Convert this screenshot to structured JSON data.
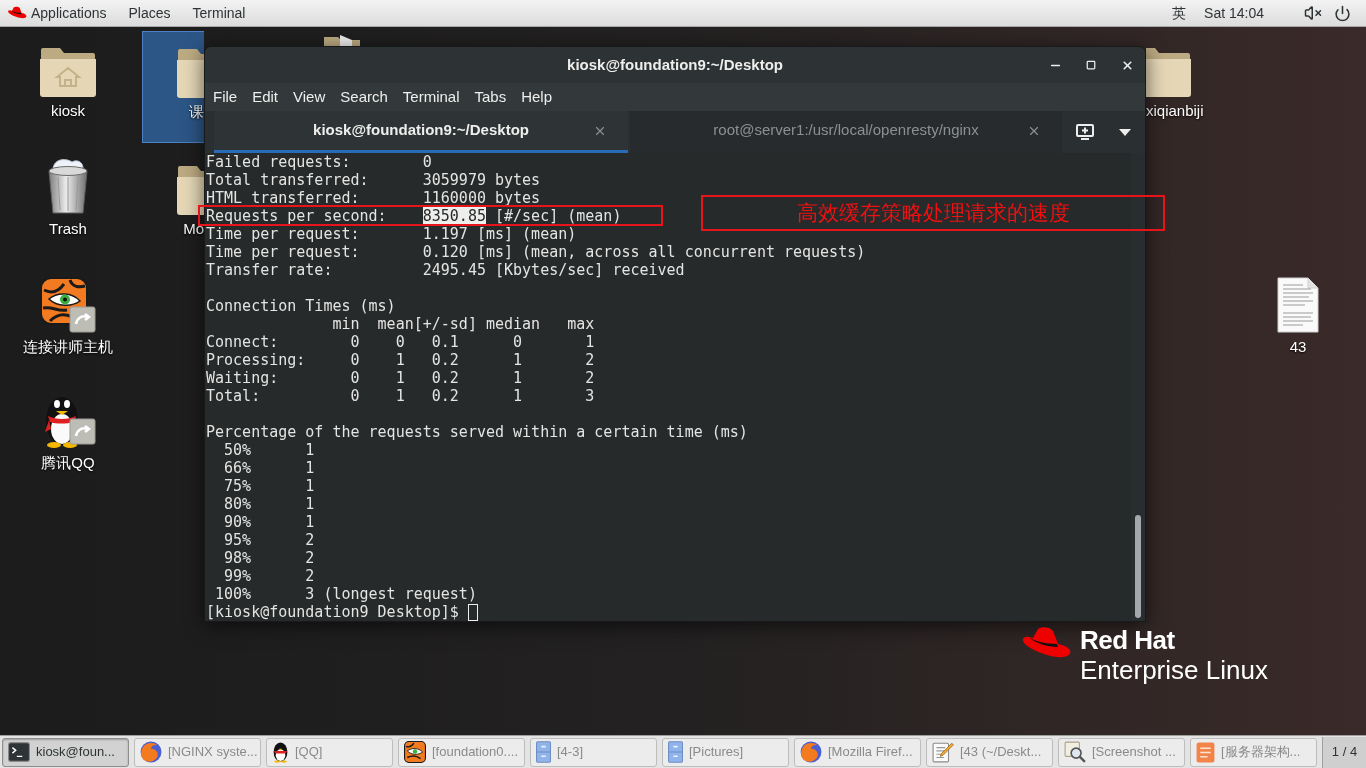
{
  "top_bar": {
    "menus": [
      "Applications",
      "Places",
      "Terminal"
    ],
    "input_method": "英",
    "clock": "Sat 14:04"
  },
  "desktop_icons": [
    {
      "kind": "home-folder",
      "label": "kiosk",
      "selected": false
    },
    {
      "kind": "trash",
      "label": "Trash",
      "selected": false
    },
    {
      "kind": "remote-app",
      "label": "连接讲师主机",
      "selected": false
    },
    {
      "kind": "chat-app",
      "label": "腾讯QQ",
      "selected": false
    },
    {
      "kind": "folder",
      "label": "课",
      "selected": true
    },
    {
      "kind": "folder",
      "label": "Mo",
      "selected": false
    },
    {
      "kind": "folder",
      "label": "xiqianbiji",
      "selected": false
    },
    {
      "kind": "document",
      "label": "43",
      "selected": false
    }
  ],
  "terminal": {
    "title": "kiosk@foundation9:~/Desktop",
    "menu": [
      "File",
      "Edit",
      "View",
      "Search",
      "Terminal",
      "Tabs",
      "Help"
    ],
    "tabs": [
      {
        "label": "kiosk@foundation9:~/Desktop",
        "selected": true
      },
      {
        "label": "root@server1:/usr/local/openresty/nginx",
        "selected": false
      }
    ],
    "lines": [
      {
        "kind": "text",
        "text": "Failed requests:        0"
      },
      {
        "kind": "text",
        "text": "Total transferred:      3059979 bytes"
      },
      {
        "kind": "text",
        "text": "HTML transferred:       1160000 bytes"
      },
      {
        "kind": "parts",
        "parts": [
          {
            "text": "Requests per second:    ",
            "selected": false
          },
          {
            "text": "8350.85",
            "selected": true
          },
          {
            "text": " [#/sec] (mean)",
            "selected": false
          }
        ]
      },
      {
        "kind": "text",
        "text": "Time per request:       1.197 [ms] (mean)"
      },
      {
        "kind": "text",
        "text": "Time per request:       0.120 [ms] (mean, across all concurrent requests)"
      },
      {
        "kind": "text",
        "text": "Transfer rate:          2495.45 [Kbytes/sec] received"
      },
      {
        "kind": "blank"
      },
      {
        "kind": "text",
        "text": "Connection Times (ms)"
      },
      {
        "kind": "text",
        "text": "              min  mean[+/-sd] median   max"
      },
      {
        "kind": "text",
        "text": "Connect:        0    0   0.1      0       1"
      },
      {
        "kind": "text",
        "text": "Processing:     0    1   0.2      1       2"
      },
      {
        "kind": "text",
        "text": "Waiting:        0    1   0.2      1       2"
      },
      {
        "kind": "text",
        "text": "Total:          0    1   0.2      1       3"
      },
      {
        "kind": "blank"
      },
      {
        "kind": "text",
        "text": "Percentage of the requests served within a certain time (ms)"
      },
      {
        "kind": "text",
        "text": "  50%      1"
      },
      {
        "kind": "text",
        "text": "  66%      1"
      },
      {
        "kind": "text",
        "text": "  75%      1"
      },
      {
        "kind": "text",
        "text": "  80%      1"
      },
      {
        "kind": "text",
        "text": "  90%      1"
      },
      {
        "kind": "text",
        "text": "  95%      2"
      },
      {
        "kind": "text",
        "text": "  98%      2"
      },
      {
        "kind": "text",
        "text": "  99%      2"
      },
      {
        "kind": "text",
        "text": " 100%      3 (longest request)"
      }
    ],
    "prompt": "[kiosk@foundation9 Desktop]$"
  },
  "annotations": [
    {
      "kind": "frame"
    },
    {
      "kind": "callout",
      "text": "高效缓存策略处理请求的速度"
    }
  ],
  "brand": {
    "name": "Red Hat",
    "product": "Enterprise Linux"
  },
  "taskbar": {
    "items": [
      {
        "kind": "terminal",
        "label": "kiosk@foun...",
        "selected": true
      },
      {
        "kind": "browser",
        "label": "[NGINX syste...",
        "selected": false
      },
      {
        "kind": "chat-app",
        "label": "[QQ]",
        "selected": false
      },
      {
        "kind": "remote-app",
        "label": "[foundation0....",
        "selected": false
      },
      {
        "kind": "file-manager",
        "label": "[4-3]",
        "selected": false
      },
      {
        "kind": "file-manager",
        "label": "[Pictures]",
        "selected": false
      },
      {
        "kind": "browser",
        "label": "[Mozilla Firef...",
        "selected": false
      },
      {
        "kind": "text-editor",
        "label": "[43 (~/Deskt...",
        "selected": false
      },
      {
        "kind": "screenshot",
        "label": "[Screenshot ...",
        "selected": false
      },
      {
        "kind": "office-doc",
        "label": "[服务器架构...",
        "selected": false
      }
    ],
    "workspace": "1 / 4"
  }
}
